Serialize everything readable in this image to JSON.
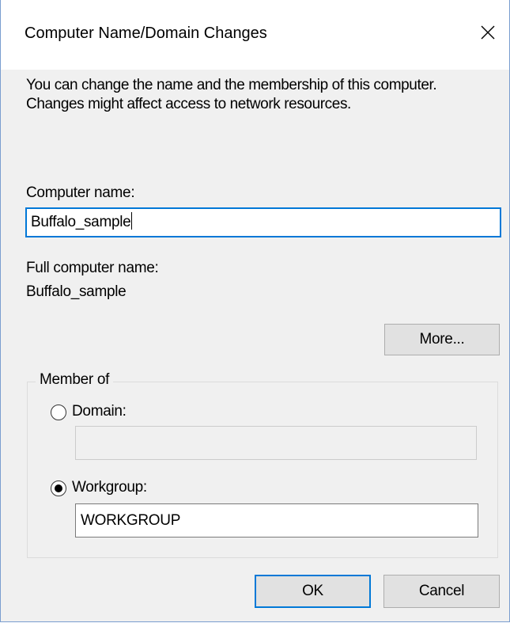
{
  "window": {
    "title": "Computer Name/Domain Changes"
  },
  "description": "You can change the name and the membership of this computer. Changes might affect access to network resources.",
  "computer_name": {
    "label": "Computer name:",
    "value": "Buffalo_sample"
  },
  "full_computer_name": {
    "label": "Full computer name:",
    "value": "Buffalo_sample"
  },
  "buttons": {
    "more": "More...",
    "ok": "OK",
    "cancel": "Cancel"
  },
  "member_of": {
    "legend": "Member of",
    "domain": {
      "label": "Domain:",
      "selected": false,
      "value": ""
    },
    "workgroup": {
      "label": "Workgroup:",
      "selected": true,
      "value": "WORKGROUP"
    }
  },
  "icons": {
    "close": "close-icon",
    "radio": "radio-button-icon"
  },
  "colors": {
    "accent": "#0078d7",
    "dialog_bg": "#f0f0f0",
    "button_bg": "#e1e1e1"
  }
}
